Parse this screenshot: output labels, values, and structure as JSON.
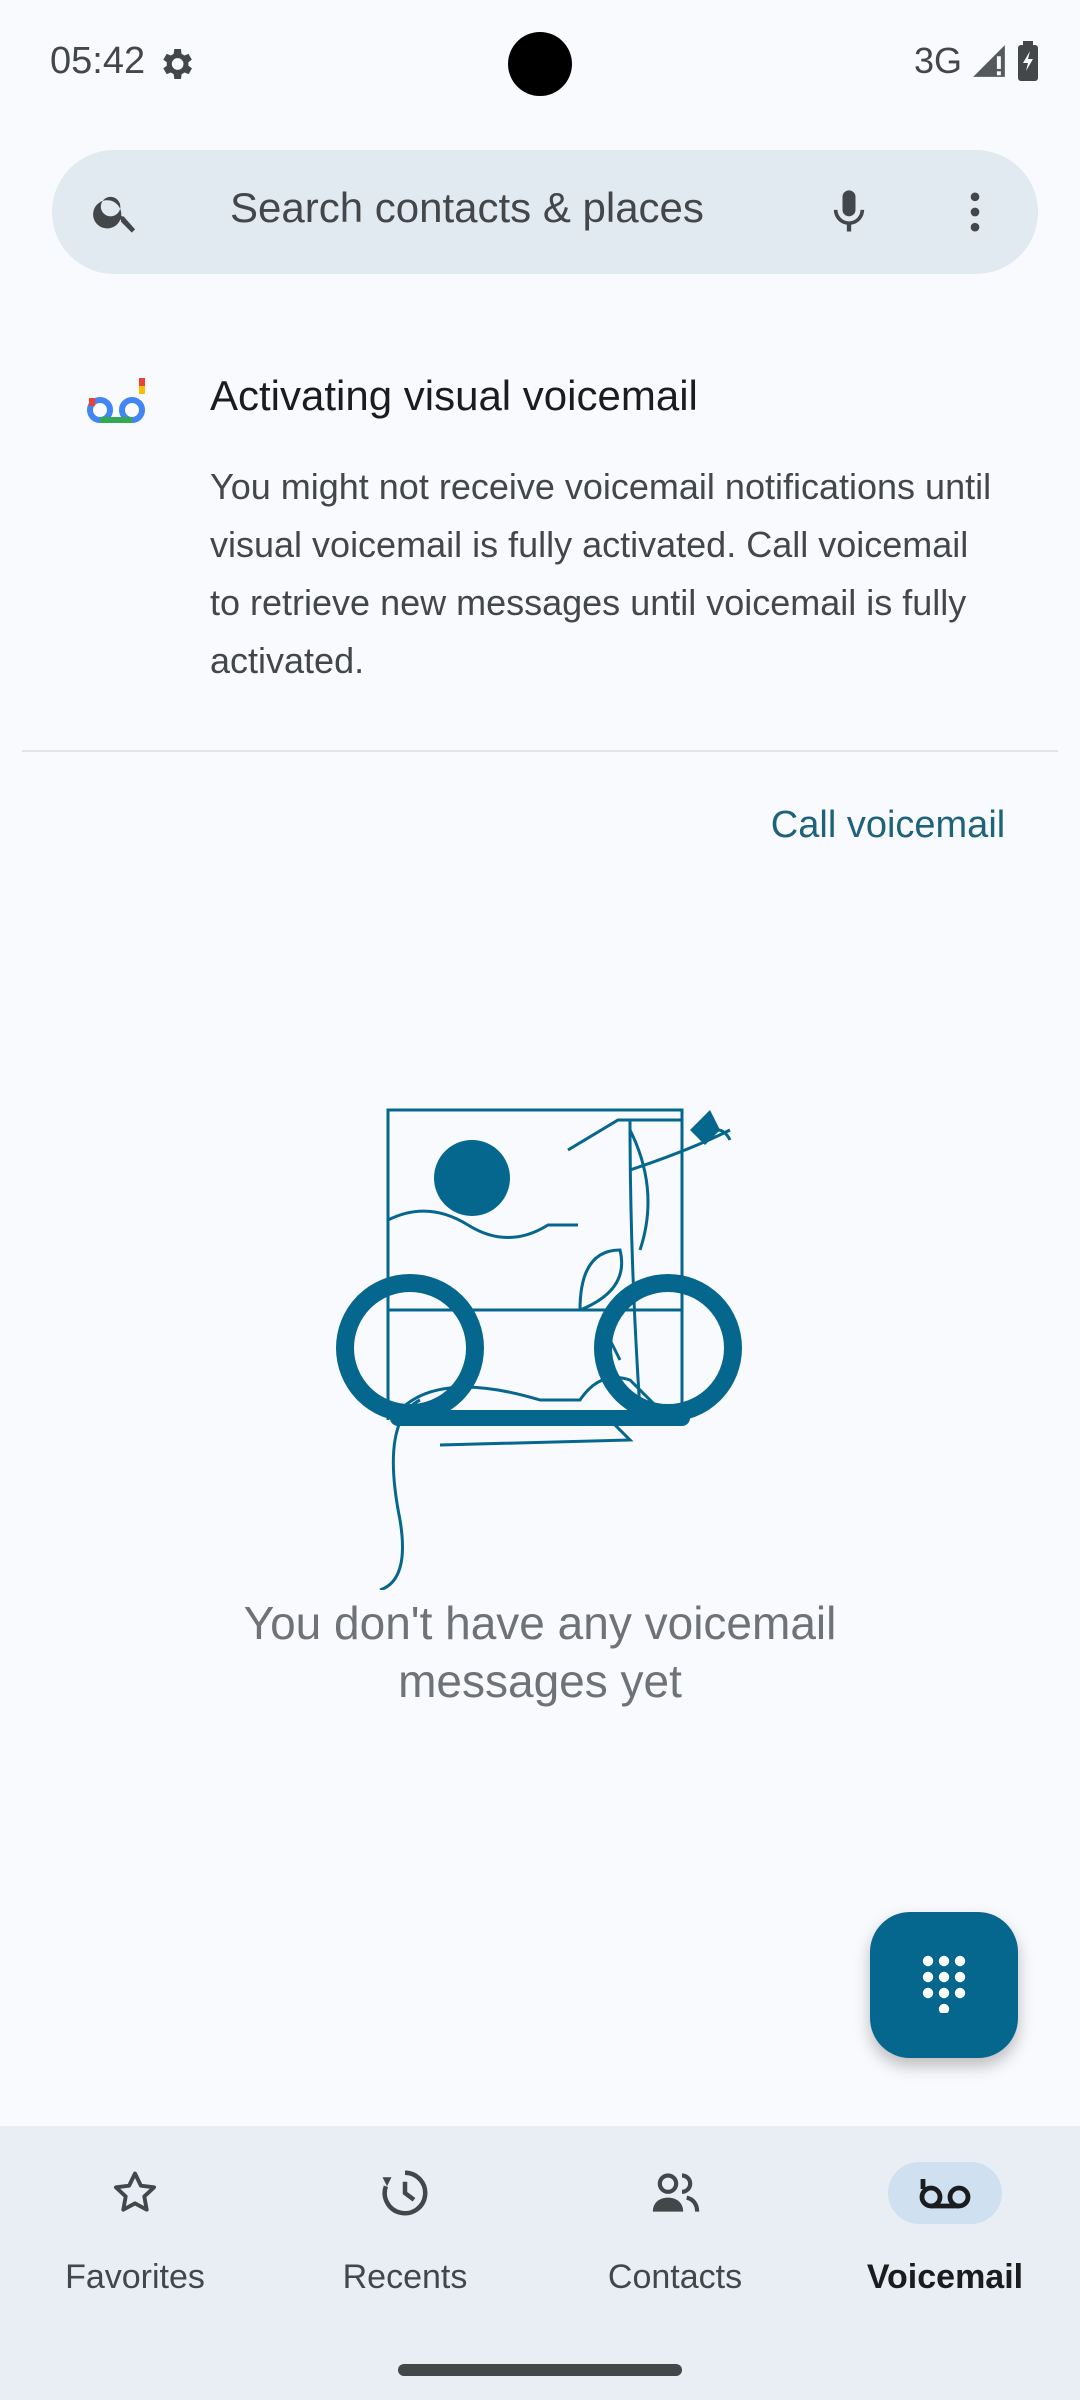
{
  "status_bar": {
    "time": "05:42",
    "network": "3G",
    "icons": [
      "gear-icon",
      "signal-icon",
      "battery-icon"
    ]
  },
  "search": {
    "placeholder": "Search contacts & places",
    "icons": [
      "search-icon",
      "mic-icon",
      "more-vert-icon"
    ]
  },
  "voicemail_card": {
    "icon": "voicemail-logo-icon",
    "title": "Activating visual voicemail",
    "body": "You might not receive voicemail notifications until visual voicemail is fully activated. Call voicemail to retrieve new messages until voicemail is fully activated.",
    "action_label": "Call voicemail"
  },
  "empty_state": {
    "illustration": "cat-on-window-illustration",
    "message": "You don't have any voicemail messages yet"
  },
  "fab": {
    "icon": "dialpad-icon"
  },
  "bottom_nav": {
    "items": [
      {
        "label": "Favorites",
        "icon": "star-icon",
        "active": false
      },
      {
        "label": "Recents",
        "icon": "clock-icon",
        "active": false
      },
      {
        "label": "Contacts",
        "icon": "contacts-icon",
        "active": false
      },
      {
        "label": "Voicemail",
        "icon": "voicemail-icon",
        "active": true
      }
    ]
  },
  "colors": {
    "accent": "#05668e",
    "link": "#1e627c",
    "background": "#f9fafd",
    "search_bg": "#e1e9f1",
    "nav_bg": "#e9eef4",
    "nav_active_pill": "#cfe0f0"
  }
}
